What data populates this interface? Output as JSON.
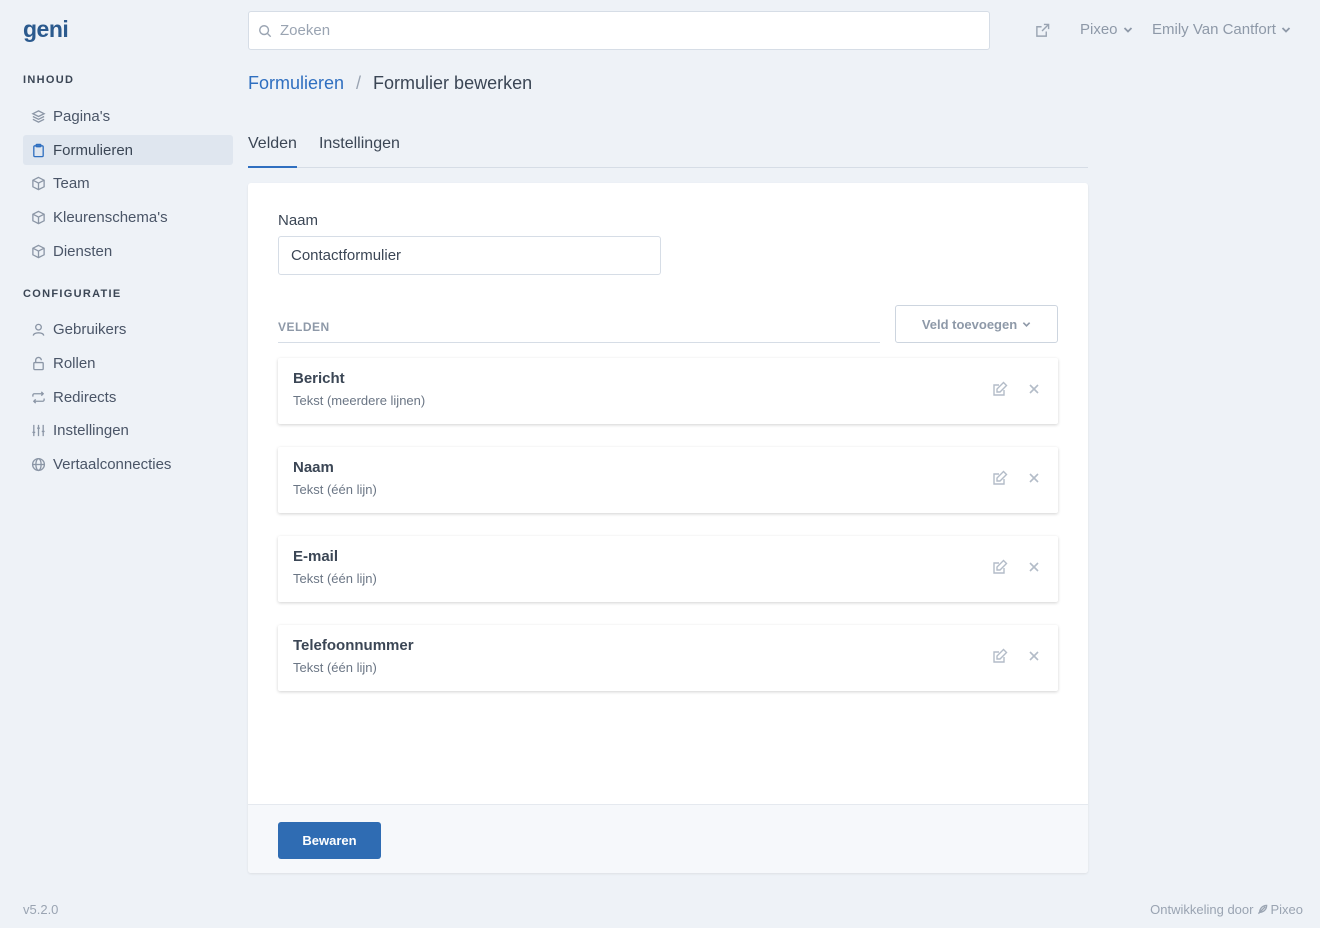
{
  "app": {
    "logo_text": "geni"
  },
  "sidebar": {
    "sections": [
      {
        "title": "INHOUD"
      },
      {
        "title": "CONFIGURATIE"
      }
    ],
    "content_items": [
      {
        "label": "Pagina's",
        "icon": "layers-icon"
      },
      {
        "label": "Formulieren",
        "icon": "clipboard-icon",
        "active": true
      },
      {
        "label": "Team",
        "icon": "cube-icon"
      },
      {
        "label": "Kleurenschema's",
        "icon": "cube-icon"
      },
      {
        "label": "Diensten",
        "icon": "cube-icon"
      }
    ],
    "config_items": [
      {
        "label": "Gebruikers",
        "icon": "user-icon"
      },
      {
        "label": "Rollen",
        "icon": "lock-icon"
      },
      {
        "label": "Redirects",
        "icon": "repeat-icon"
      },
      {
        "label": "Instellingen",
        "icon": "sliders-icon"
      },
      {
        "label": "Vertaalconnecties",
        "icon": "globe-icon"
      }
    ]
  },
  "topbar": {
    "search_placeholder": "Zoeken",
    "org_menu": "Pixeo",
    "user_menu": "Emily Van Cantfort"
  },
  "breadcrumb": {
    "parent": "Formulieren",
    "separator": "/",
    "current": "Formulier bewerken"
  },
  "tabs": [
    {
      "label": "Velden",
      "active": true
    },
    {
      "label": "Instellingen"
    }
  ],
  "form": {
    "name_label": "Naam",
    "name_value": "Contactformulier",
    "fields_heading": "VELDEN",
    "add_field_label": "Veld toevoegen",
    "fields": [
      {
        "title": "Bericht",
        "type": "Tekst (meerdere lijnen)"
      },
      {
        "title": "Naam",
        "type": "Tekst (één lijn)"
      },
      {
        "title": "E-mail",
        "type": "Tekst (één lijn)"
      },
      {
        "title": "Telefoonnummer",
        "type": "Tekst (één lijn)"
      }
    ],
    "save_label": "Bewaren"
  },
  "footer": {
    "version": "v5.2.0",
    "credits_prefix": "Ontwikkeling door",
    "credits_brand": "Pixeo"
  },
  "colors": {
    "accent": "#2f6fc0",
    "button": "#2f6cb3",
    "background": "#eef2f7"
  }
}
